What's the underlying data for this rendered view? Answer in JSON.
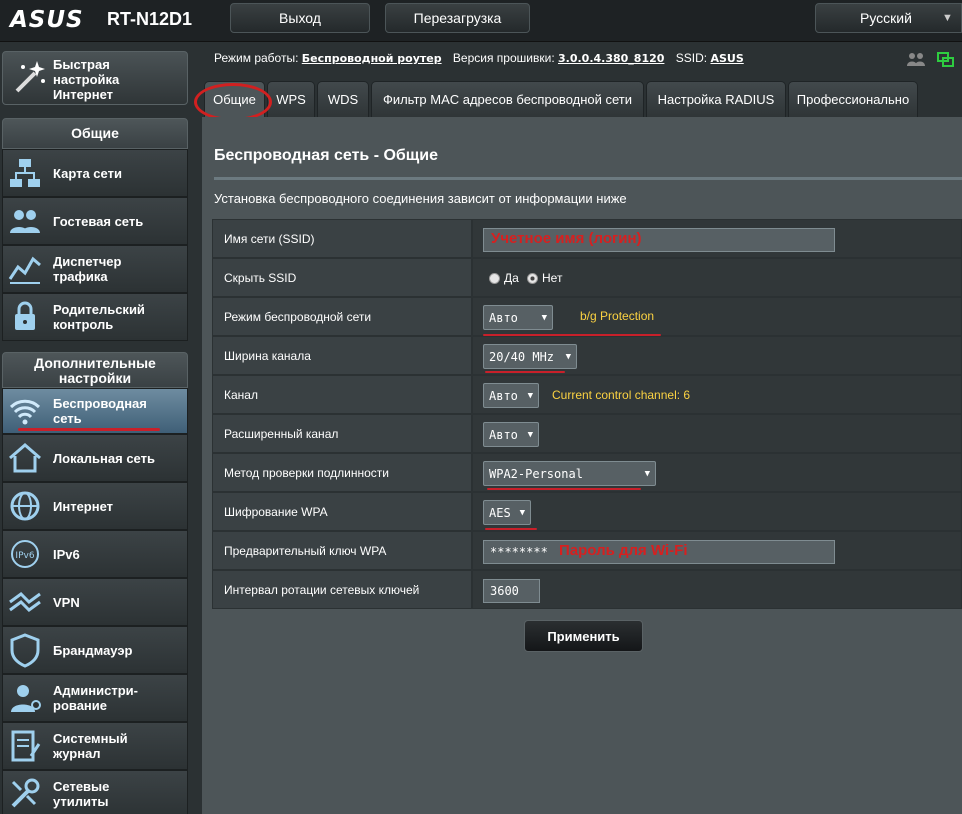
{
  "header": {
    "brand": "ASUS",
    "model": "RT-N12D1",
    "logout_label": "Выход",
    "reboot_label": "Перезагрузка",
    "language": "Русский"
  },
  "sidebar": {
    "quick_setup": "Быстрая\nнастройка\nИнтернет",
    "general_header": "Общие",
    "general_items": [
      {
        "label": "Карта сети",
        "icon": "network-map-icon"
      },
      {
        "label": "Гостевая сеть",
        "icon": "guest-network-icon"
      },
      {
        "label": "Диспетчер\nтрафика",
        "icon": "traffic-manager-icon"
      },
      {
        "label": "Родительский\nконтроль",
        "icon": "parental-control-icon"
      }
    ],
    "advanced_header": "Дополнительные\nнастройки",
    "advanced_items": [
      {
        "label": "Беспроводная\nсеть",
        "icon": "wireless-icon",
        "active": true
      },
      {
        "label": "Локальная сеть",
        "icon": "lan-home-icon"
      },
      {
        "label": "Интернет",
        "icon": "globe-icon"
      },
      {
        "label": "IPv6",
        "icon": "ipv6-icon"
      },
      {
        "label": "VPN",
        "icon": "vpn-icon"
      },
      {
        "label": "Брандмауэр",
        "icon": "firewall-shield-icon"
      },
      {
        "label": "Администри-\nрование",
        "icon": "administration-icon"
      },
      {
        "label": "Системный\nжурнал",
        "icon": "system-log-icon"
      },
      {
        "label": "Сетевые\nутилиты",
        "icon": "network-tools-icon"
      }
    ]
  },
  "status": {
    "mode_label": "Режим работы:",
    "mode_value": "Беспроводной роутер",
    "fw_label": "Версия прошивки:",
    "fw_value": "3.0.0.4.380_8120",
    "ssid_label": "SSID:",
    "ssid_value": "ASUS"
  },
  "tabs": [
    "Общие",
    "WPS",
    "WDS",
    "Фильтр MAC адресов беспроводной сети",
    "Настройка RADIUS",
    "Профессионально"
  ],
  "main": {
    "title": "Беспроводная сеть - Общие",
    "description": "Установка беспроводного соединения зависит от информации ниже",
    "rows": [
      {
        "label": "Имя сети (SSID)",
        "value": "",
        "annotation": "Учетное имя (логин)"
      },
      {
        "label": "Скрыть SSID",
        "radio_yes": "Да",
        "radio_no": "Нет"
      },
      {
        "label": "Режим беспроводной сети",
        "value": "Авто",
        "hint": "b/g Protection"
      },
      {
        "label": "Ширина канала",
        "value": "20/40 MHz"
      },
      {
        "label": "Канал",
        "value": "Авто",
        "hint": "Current control channel: 6"
      },
      {
        "label": "Расширенный канал",
        "value": "Авто"
      },
      {
        "label": "Метод проверки подлинности",
        "value": "WPA2-Personal"
      },
      {
        "label": "Шифрование WPA",
        "value": "AES"
      },
      {
        "label": "Предварительный ключ WPA",
        "value": "********",
        "annotation": "Пароль для Wi-Fi"
      },
      {
        "label": "Интервал ротации сетевых ключей",
        "value": "3600"
      }
    ],
    "apply_label": "Применить"
  },
  "colors": {
    "annotation_red": "#d62020",
    "hint_yellow": "#fbd242",
    "active_blue": "#4f7089"
  }
}
